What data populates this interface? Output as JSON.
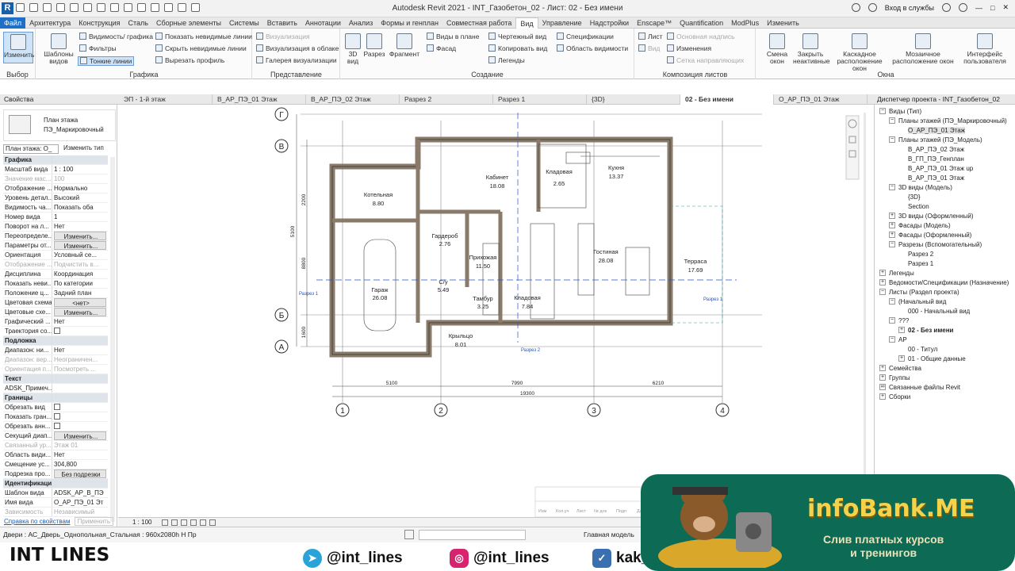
{
  "window": {
    "title": "Autodesk Revit 2021 - INT_Газобетон_02 - Лист: 02 - Без имени",
    "signin": "Вход в службы"
  },
  "ribbon_tabs": [
    "Файл",
    "Архитектура",
    "Конструкция",
    "Сталь",
    "Сборные элементы",
    "Системы",
    "Вставить",
    "Аннотации",
    "Анализ",
    "Формы и генплан",
    "Совместная работа",
    "Вид",
    "Управление",
    "Надстройки",
    "Enscape™",
    "Quantification",
    "ModPlus",
    "Изменить"
  ],
  "ribbon": {
    "select": {
      "modify": "Изменить",
      "label": "Выбор"
    },
    "graphics": {
      "label": "Графика",
      "templates": "Шаблоны видов",
      "visibility": "Видимость/ графика",
      "filters": "Фильтры",
      "thin_lines": "Тонкие линии",
      "show_hidden": "Показать невидимые линии",
      "hide_hidden": "Скрыть невидимые линии",
      "cut_profile": "Вырезать профиль"
    },
    "presentation": {
      "label": "Представление",
      "render": "Визуализация",
      "render_cloud": "Визуализация в облаке",
      "gallery": "Галерея визуализации"
    },
    "create": {
      "label": "Создание",
      "view3d": "3D вид",
      "section": "Разрез",
      "callout": "Фрагмент",
      "plan_views": "Виды в плане",
      "elevation": "Фасад",
      "drafting": "Чертежный вид",
      "duplicate": "Копировать вид",
      "legends": "Легенды",
      "schedules": "Спецификации",
      "scope_box": "Область видимости"
    },
    "sheet": {
      "label": "Композиция листов",
      "sheet": "Лист",
      "view": "Вид",
      "title_block": "Основная надпись",
      "revisions": "Изменения",
      "guide_grid": "Сетка направляющих"
    },
    "windows": {
      "label": "Окна",
      "switch": "Смена окон",
      "close_inactive": "Закрыть неактивные",
      "cascade": "Каскадное расположение окон",
      "tile": "Мозаичное расположение окон",
      "ui": "Интерфейс пользователя"
    }
  },
  "panels": {
    "properties": "Свойства",
    "browser": "Диспетчер проекта - INT_Газобетон_02"
  },
  "doc_tabs": [
    "ЭП - 1-й этаж",
    "В_АР_ПЭ_01 Этаж",
    "В_АР_ПЭ_02 Этаж",
    "Разрез 2",
    "Разрез 1",
    "{3D}",
    "02 - Без имени",
    "О_АР_ПЭ_01 Этаж"
  ],
  "properties": {
    "type_name_1": "План этажа",
    "type_name_2": "ПЭ_Маркировочный",
    "instance": "План этажа: О_",
    "edit_type": "Изменить тип",
    "rows": [
      {
        "k": "Графика",
        "v": "",
        "cat": true
      },
      {
        "k": "Масштаб вида",
        "v": "1 : 100"
      },
      {
        "k": "Значение мас...",
        "v": "100",
        "dis": true
      },
      {
        "k": "Отображение ...",
        "v": "Нормально"
      },
      {
        "k": "Уровень детал...",
        "v": "Высокий"
      },
      {
        "k": "Видимость ча...",
        "v": "Показать оба"
      },
      {
        "k": "Номер вида",
        "v": "1"
      },
      {
        "k": "Поворот на л...",
        "v": "Нет"
      },
      {
        "k": "Переопределе...",
        "v": "Изменить...",
        "btn": true
      },
      {
        "k": "Параметры от...",
        "v": "Изменить...",
        "btn": true
      },
      {
        "k": "Ориентация",
        "v": "Условный се..."
      },
      {
        "k": "Отображение ...",
        "v": "Подчистить в...",
        "dis": true
      },
      {
        "k": "Дисциплина",
        "v": "Координация"
      },
      {
        "k": "Показать неви...",
        "v": "По категории"
      },
      {
        "k": "Положение ц...",
        "v": "Задний план"
      },
      {
        "k": "Цветовая схема",
        "v": "<нет>",
        "btn": true
      },
      {
        "k": "Цветовые схе...",
        "v": "Изменить...",
        "btn": true
      },
      {
        "k": "Графический ...",
        "v": "Нет"
      },
      {
        "k": "Траектория со...",
        "v": "",
        "cb": true
      },
      {
        "k": "Подложка",
        "v": "",
        "cat": true
      },
      {
        "k": "Диапазон: ни...",
        "v": "Нет"
      },
      {
        "k": "Диапазон: вер...",
        "v": "Неограничен...",
        "dis": true
      },
      {
        "k": "Ориентация п...",
        "v": "Посмотреть ...",
        "dis": true
      },
      {
        "k": "Текст",
        "v": "",
        "cat": true
      },
      {
        "k": "ADSK_Примеч...",
        "v": ""
      },
      {
        "k": "Границы",
        "v": "",
        "cat": true
      },
      {
        "k": "Обрезать вид",
        "v": "",
        "cb": true
      },
      {
        "k": "Показать гран...",
        "v": "",
        "cb": true
      },
      {
        "k": "Обрезать анн...",
        "v": "",
        "cb": true
      },
      {
        "k": "Секущий диап...",
        "v": "Изменить...",
        "btn": true
      },
      {
        "k": "Связанный ур...",
        "v": "Этаж 01",
        "dis": true
      },
      {
        "k": "Область види...",
        "v": "Нет"
      },
      {
        "k": "Смещение ус...",
        "v": "304,800"
      },
      {
        "k": "Подрезка про...",
        "v": "Без подрезки",
        "btn": true
      },
      {
        "k": "Идентификация",
        "v": "",
        "cat": true
      },
      {
        "k": "Шаблон вида",
        "v": "ADSK_АР_В_ПЭ"
      },
      {
        "k": "Имя вида",
        "v": "О_АР_ПЭ_01 Эт"
      },
      {
        "k": "Зависимость",
        "v": "Независимый",
        "dis": true
      }
    ],
    "help": "Справка по свойствам",
    "apply": "Применить"
  },
  "browser_tree": [
    {
      "t": "Виды (Тип)",
      "d": 0,
      "e": "−"
    },
    {
      "t": "Планы этажей (ПЭ_Маркировочный)",
      "d": 1,
      "e": "−"
    },
    {
      "t": "О_АР_ПЭ_01 Этаж",
      "d": 2,
      "hi": true
    },
    {
      "t": "Планы этажей (ПЭ_Модель)",
      "d": 1,
      "e": "−"
    },
    {
      "t": "В_АР_ПЭ_02 Этаж",
      "d": 2
    },
    {
      "t": "В_ГП_ПЭ_Генплан",
      "d": 2
    },
    {
      "t": "В_АР_ПЭ_01 Этаж up",
      "d": 2
    },
    {
      "t": "В_АР_ПЭ_01 Этаж",
      "d": 2
    },
    {
      "t": "3D виды (Модель)",
      "d": 1,
      "e": "−"
    },
    {
      "t": "{3D}",
      "d": 2
    },
    {
      "t": "Section",
      "d": 2
    },
    {
      "t": "3D виды (Оформленный)",
      "d": 1,
      "e": "+"
    },
    {
      "t": "Фасады (Модель)",
      "d": 1,
      "e": "+"
    },
    {
      "t": "Фасады (Оформленный)",
      "d": 1,
      "e": "+"
    },
    {
      "t": "Разрезы (Вспомогательный)",
      "d": 1,
      "e": "−"
    },
    {
      "t": "Разрез 2",
      "d": 2
    },
    {
      "t": "Разрез 1",
      "d": 2
    },
    {
      "t": "Легенды",
      "d": 0,
      "e": "+"
    },
    {
      "t": "Ведомости/Спецификации (Назначение)",
      "d": 0,
      "e": "+"
    },
    {
      "t": "Листы (Раздел проекта)",
      "d": 0,
      "e": "−"
    },
    {
      "t": "(Начальный вид",
      "d": 1,
      "e": "−"
    },
    {
      "t": "000 - Начальный вид",
      "d": 2
    },
    {
      "t": "???",
      "d": 1,
      "e": "−"
    },
    {
      "t": "02 - Без имени",
      "d": 2,
      "bold": true,
      "e": "+"
    },
    {
      "t": "АР",
      "d": 1,
      "e": "−"
    },
    {
      "t": "00 - Титул",
      "d": 2
    },
    {
      "t": "01 - Общие данные",
      "d": 2,
      "e": "+"
    },
    {
      "t": "Семейства",
      "d": 0,
      "e": "+"
    },
    {
      "t": "Группы",
      "d": 0,
      "e": "+"
    },
    {
      "t": "Связанные файлы Revit",
      "d": 0,
      "e": "∞"
    },
    {
      "t": "Сборки",
      "d": 0,
      "e": "+"
    }
  ],
  "plan": {
    "grid_rows": [
      "В",
      "Б",
      "А",
      "Г"
    ],
    "grid_cols": [
      "1",
      "2",
      "3",
      "4"
    ],
    "dims_bottom": [
      "5100",
      "7990",
      "6210"
    ],
    "dim_total": "19300",
    "dims_left": [
      "2200",
      "5100",
      "8800",
      "1600"
    ],
    "rooms": [
      {
        "name": "Котельная",
        "area": "8.80"
      },
      {
        "name": "Кабинет",
        "area": "18.08"
      },
      {
        "name": "Кухня",
        "area": "13.37"
      },
      {
        "name": "Прихожая",
        "area": "11.50"
      },
      {
        "name": "Гостиная",
        "area": "28.08"
      },
      {
        "name": "Терраса",
        "area": "17.69"
      },
      {
        "name": "Гараж",
        "area": "26.08"
      },
      {
        "name": "Гардероб",
        "area": "2.76"
      },
      {
        "name": "Тамбур",
        "area": "3.25"
      },
      {
        "name": "С/у",
        "area": "5.49"
      },
      {
        "name": "Кладовая",
        "area": "7.84"
      },
      {
        "name": "Крыльцо",
        "area": "8.01"
      },
      {
        "name": "Кладовая",
        "area": "2.65"
      }
    ],
    "section1": "Разрез 1",
    "section2": "Разрез 2",
    "sheet_labels": [
      "Изм",
      "Кол.уч",
      "Лист",
      "№ док",
      "Подп",
      "Дата"
    ]
  },
  "status": {
    "scale": "1 : 100",
    "hint": "Двери : АС_Дверь_Однопольная_Стальная : 960x2080h Н Пр",
    "model": "Главная модель"
  },
  "branding": {
    "brand": "INT LINES",
    "telegram": "@int_lines",
    "instagram": "@int_lines",
    "vk": "kak_",
    "wm_title": "infoBank.ME",
    "wm_sub_1": "Слив платных курсов",
    "wm_sub_2": "и тренингов"
  }
}
